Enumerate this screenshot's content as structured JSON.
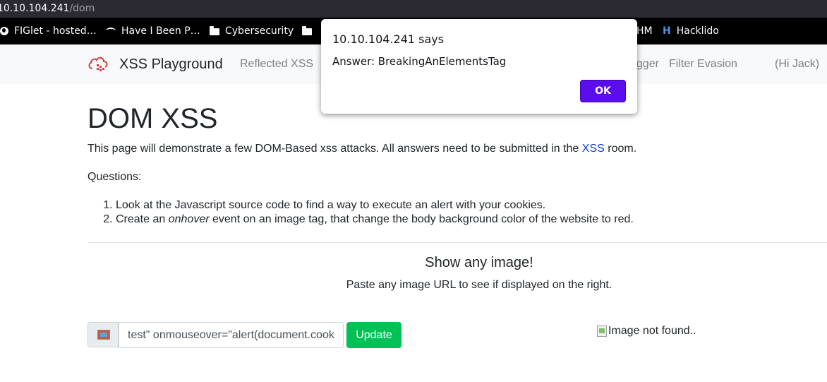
{
  "browser": {
    "url_host": "10.10.104.241",
    "url_path": "/dom"
  },
  "bookmarks": [
    {
      "label": "FIGlet - hosted…",
      "icon": "globe-icon"
    },
    {
      "label": "Have I Been P…",
      "icon": "mask-icon"
    },
    {
      "label": "Cybersecurity",
      "icon": "folder-icon"
    },
    {
      "label": "",
      "icon": "folder-icon"
    },
    {
      "label": "HM",
      "icon": ""
    },
    {
      "label": "Hacklido",
      "icon": "hacklido-icon"
    }
  ],
  "navbar": {
    "brand": "XSS Playground",
    "links": [
      "Reflected XSS",
      "ogger",
      "Filter Evasion",
      "(Hi Jack)"
    ]
  },
  "page": {
    "title": "DOM XSS",
    "intro_before": "This page will demonstrate a few DOM-Based xss attacks. All answers need to be submitted in the ",
    "intro_link": "XSS",
    "intro_after": " room.",
    "questions_label": "Questions:",
    "q1": "Look at the Javascript source code to find a way to execute an alert with your cookies.",
    "q2_before": "Create an ",
    "q2_em": "onhover",
    "q2_after": " event on an image tag, that change the body background color of the website to red.",
    "show_title": "Show any image!",
    "show_sub": "Paste any image URL to see if displayed on the right.",
    "input_value": "test\" onmouseover=\"alert(document.cookie)\"",
    "update_label": "Update",
    "broken_image_alt": "Image not found.."
  },
  "dialog": {
    "title": "10.10.104.241 says",
    "message": "Answer: BreakingAnElementsTag",
    "ok_label": "OK"
  },
  "colors": {
    "ok_button": "#5b0eeb",
    "update_button": "#00c155",
    "link": "#0d3bd8"
  }
}
